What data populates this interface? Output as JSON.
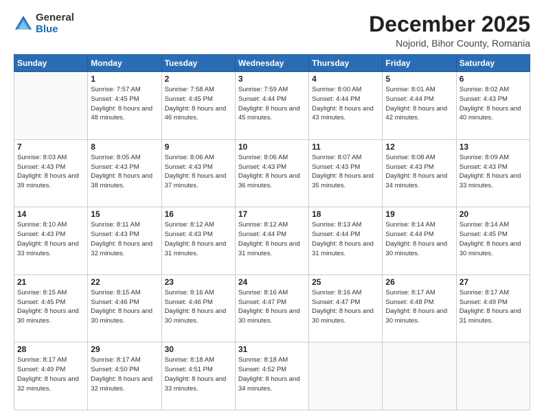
{
  "logo": {
    "general": "General",
    "blue": "Blue"
  },
  "title": {
    "month": "December 2025",
    "location": "Nojorid, Bihor County, Romania"
  },
  "days_of_week": [
    "Sunday",
    "Monday",
    "Tuesday",
    "Wednesday",
    "Thursday",
    "Friday",
    "Saturday"
  ],
  "weeks": [
    [
      {
        "day": null
      },
      {
        "day": 1,
        "sunrise": "7:57 AM",
        "sunset": "4:45 PM",
        "daylight": "8 hours and 48 minutes."
      },
      {
        "day": 2,
        "sunrise": "7:58 AM",
        "sunset": "4:45 PM",
        "daylight": "8 hours and 46 minutes."
      },
      {
        "day": 3,
        "sunrise": "7:59 AM",
        "sunset": "4:44 PM",
        "daylight": "8 hours and 45 minutes."
      },
      {
        "day": 4,
        "sunrise": "8:00 AM",
        "sunset": "4:44 PM",
        "daylight": "8 hours and 43 minutes."
      },
      {
        "day": 5,
        "sunrise": "8:01 AM",
        "sunset": "4:44 PM",
        "daylight": "8 hours and 42 minutes."
      },
      {
        "day": 6,
        "sunrise": "8:02 AM",
        "sunset": "4:43 PM",
        "daylight": "8 hours and 40 minutes."
      }
    ],
    [
      {
        "day": 7,
        "sunrise": "8:03 AM",
        "sunset": "4:43 PM",
        "daylight": "8 hours and 39 minutes."
      },
      {
        "day": 8,
        "sunrise": "8:05 AM",
        "sunset": "4:43 PM",
        "daylight": "8 hours and 38 minutes."
      },
      {
        "day": 9,
        "sunrise": "8:06 AM",
        "sunset": "4:43 PM",
        "daylight": "8 hours and 37 minutes."
      },
      {
        "day": 10,
        "sunrise": "8:06 AM",
        "sunset": "4:43 PM",
        "daylight": "8 hours and 36 minutes."
      },
      {
        "day": 11,
        "sunrise": "8:07 AM",
        "sunset": "4:43 PM",
        "daylight": "8 hours and 35 minutes."
      },
      {
        "day": 12,
        "sunrise": "8:08 AM",
        "sunset": "4:43 PM",
        "daylight": "8 hours and 34 minutes."
      },
      {
        "day": 13,
        "sunrise": "8:09 AM",
        "sunset": "4:43 PM",
        "daylight": "8 hours and 33 minutes."
      }
    ],
    [
      {
        "day": 14,
        "sunrise": "8:10 AM",
        "sunset": "4:43 PM",
        "daylight": "8 hours and 33 minutes."
      },
      {
        "day": 15,
        "sunrise": "8:11 AM",
        "sunset": "4:43 PM",
        "daylight": "8 hours and 32 minutes."
      },
      {
        "day": 16,
        "sunrise": "8:12 AM",
        "sunset": "4:43 PM",
        "daylight": "8 hours and 31 minutes."
      },
      {
        "day": 17,
        "sunrise": "8:12 AM",
        "sunset": "4:44 PM",
        "daylight": "8 hours and 31 minutes."
      },
      {
        "day": 18,
        "sunrise": "8:13 AM",
        "sunset": "4:44 PM",
        "daylight": "8 hours and 31 minutes."
      },
      {
        "day": 19,
        "sunrise": "8:14 AM",
        "sunset": "4:44 PM",
        "daylight": "8 hours and 30 minutes."
      },
      {
        "day": 20,
        "sunrise": "8:14 AM",
        "sunset": "4:45 PM",
        "daylight": "8 hours and 30 minutes."
      }
    ],
    [
      {
        "day": 21,
        "sunrise": "8:15 AM",
        "sunset": "4:45 PM",
        "daylight": "8 hours and 30 minutes."
      },
      {
        "day": 22,
        "sunrise": "8:15 AM",
        "sunset": "4:46 PM",
        "daylight": "8 hours and 30 minutes."
      },
      {
        "day": 23,
        "sunrise": "8:16 AM",
        "sunset": "4:46 PM",
        "daylight": "8 hours and 30 minutes."
      },
      {
        "day": 24,
        "sunrise": "8:16 AM",
        "sunset": "4:47 PM",
        "daylight": "8 hours and 30 minutes."
      },
      {
        "day": 25,
        "sunrise": "8:16 AM",
        "sunset": "4:47 PM",
        "daylight": "8 hours and 30 minutes."
      },
      {
        "day": 26,
        "sunrise": "8:17 AM",
        "sunset": "4:48 PM",
        "daylight": "8 hours and 30 minutes."
      },
      {
        "day": 27,
        "sunrise": "8:17 AM",
        "sunset": "4:49 PM",
        "daylight": "8 hours and 31 minutes."
      }
    ],
    [
      {
        "day": 28,
        "sunrise": "8:17 AM",
        "sunset": "4:49 PM",
        "daylight": "8 hours and 32 minutes."
      },
      {
        "day": 29,
        "sunrise": "8:17 AM",
        "sunset": "4:50 PM",
        "daylight": "8 hours and 32 minutes."
      },
      {
        "day": 30,
        "sunrise": "8:18 AM",
        "sunset": "4:51 PM",
        "daylight": "8 hours and 33 minutes."
      },
      {
        "day": 31,
        "sunrise": "8:18 AM",
        "sunset": "4:52 PM",
        "daylight": "8 hours and 34 minutes."
      },
      {
        "day": null
      },
      {
        "day": null
      },
      {
        "day": null
      }
    ]
  ]
}
